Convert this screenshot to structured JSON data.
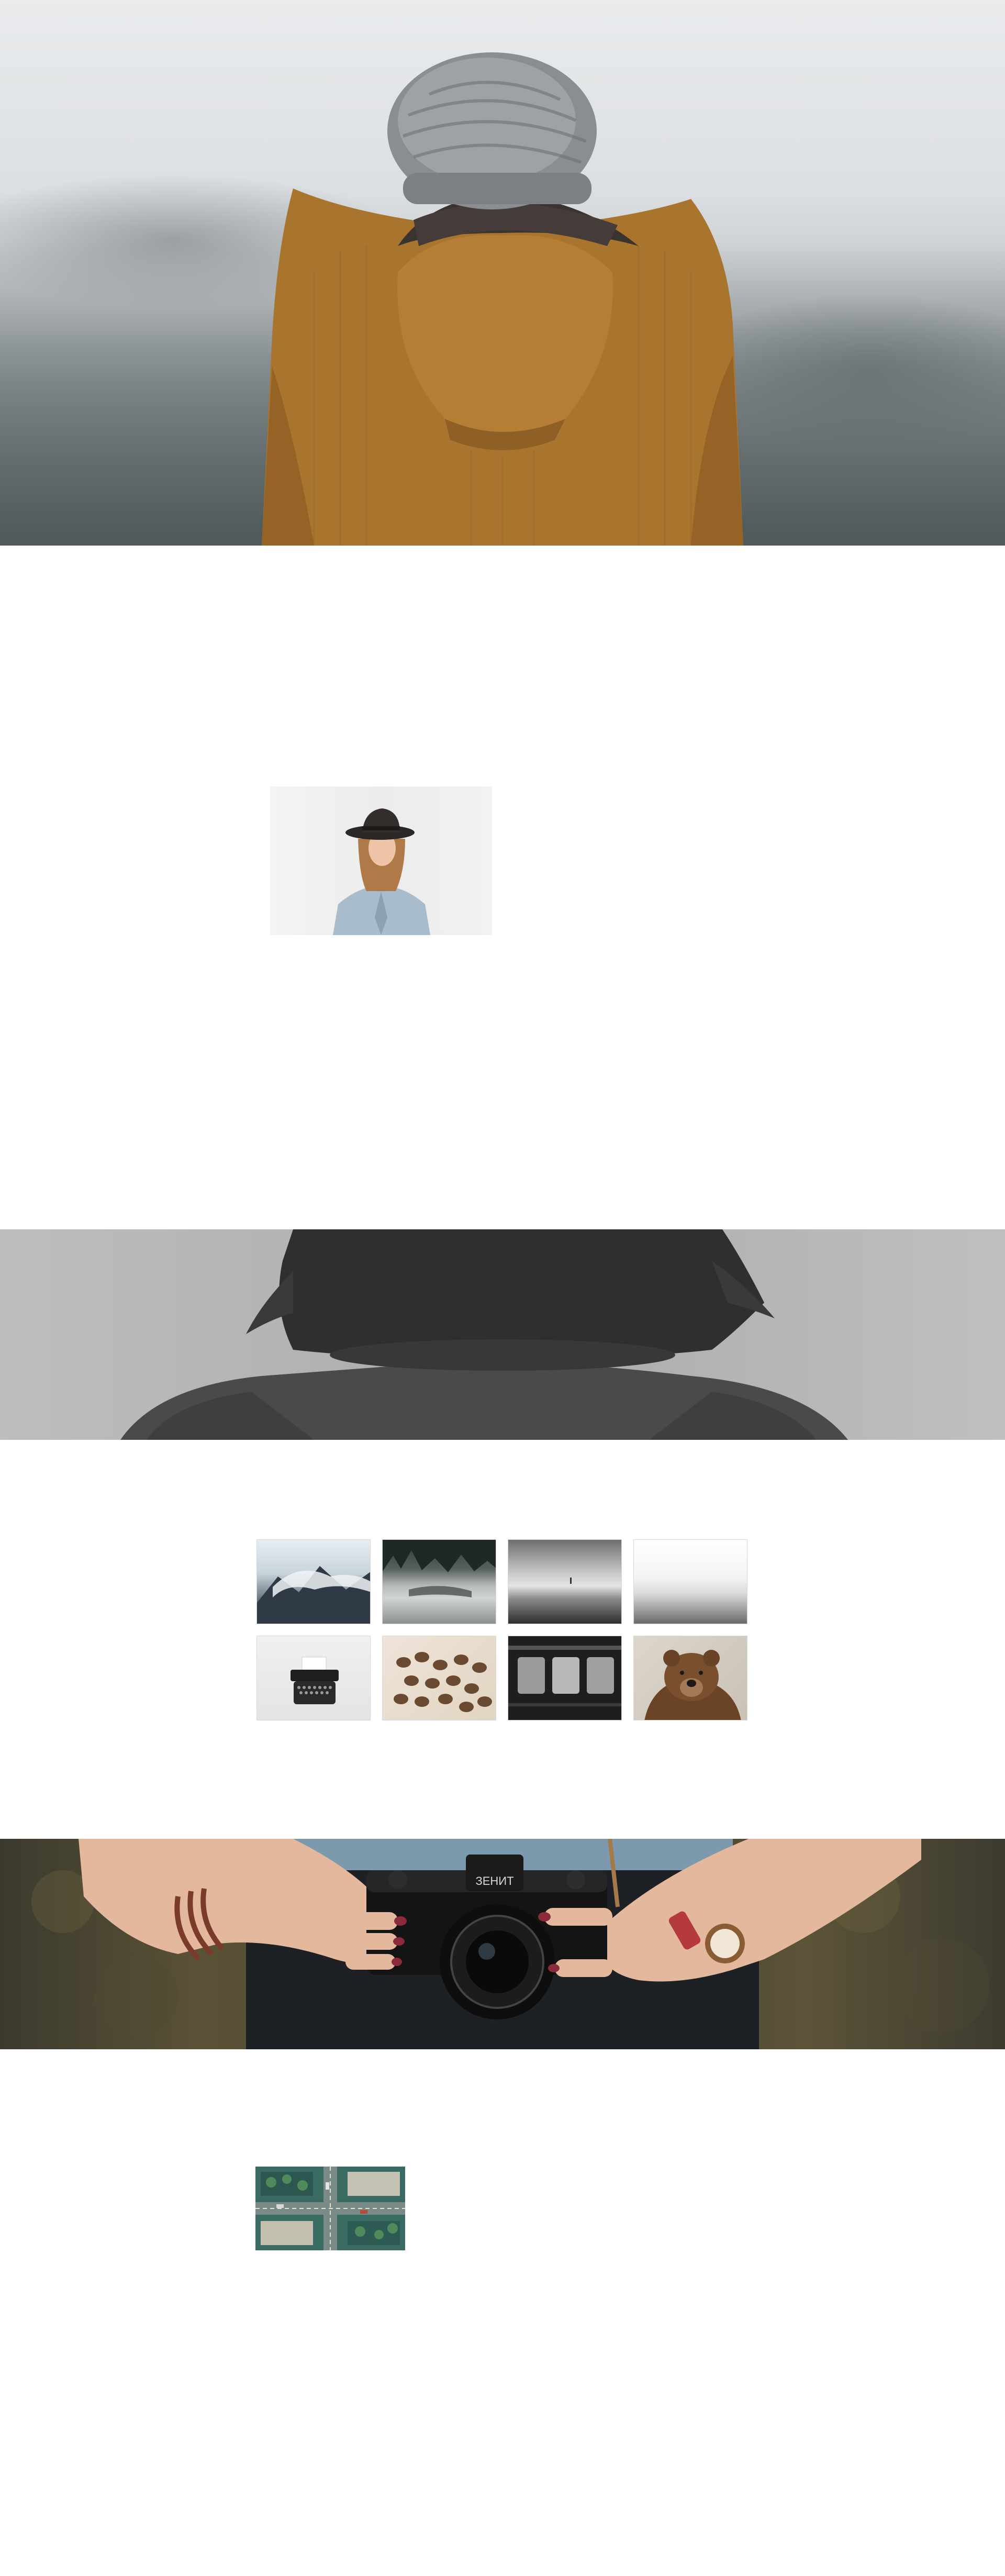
{
  "page": {
    "background": "#ffffff"
  },
  "hero": {
    "image": "person-in-corduroy-jacket-photo",
    "colors": {
      "jacket": "#a9742e",
      "beanie": "#8a8d91",
      "scarf": "#3b3330",
      "sky": "#e5e7e9"
    }
  },
  "profile_photo": {
    "image": "woman-in-hat-photo",
    "colors": {
      "hat": "#2b2727",
      "shirt": "#a9bccc"
    }
  },
  "banner_hair": {
    "image": "woman-back-grayscale-photo"
  },
  "gallery": {
    "thumbnails": [
      {
        "image": "mountain-clouds-thumbnail"
      },
      {
        "image": "misty-forest-thumbnail"
      },
      {
        "image": "grey-sea-thumbnail"
      },
      {
        "image": "foggy-horizon-thumbnail"
      },
      {
        "image": "typewriter-thumbnail"
      },
      {
        "image": "coffee-beans-thumbnail"
      },
      {
        "image": "train-windows-thumbnail"
      },
      {
        "image": "brown-bear-thumbnail"
      }
    ]
  },
  "banner_camera": {
    "image": "hands-holding-camera-photo",
    "camera_brand_text": "ЗЕНИТ",
    "colors": {
      "nails": "#8b2a3a",
      "watch_strap": "#b53a3d",
      "skin": "#e3b89c"
    }
  },
  "aerial_photo": {
    "image": "aerial-city-intersection-photo"
  }
}
